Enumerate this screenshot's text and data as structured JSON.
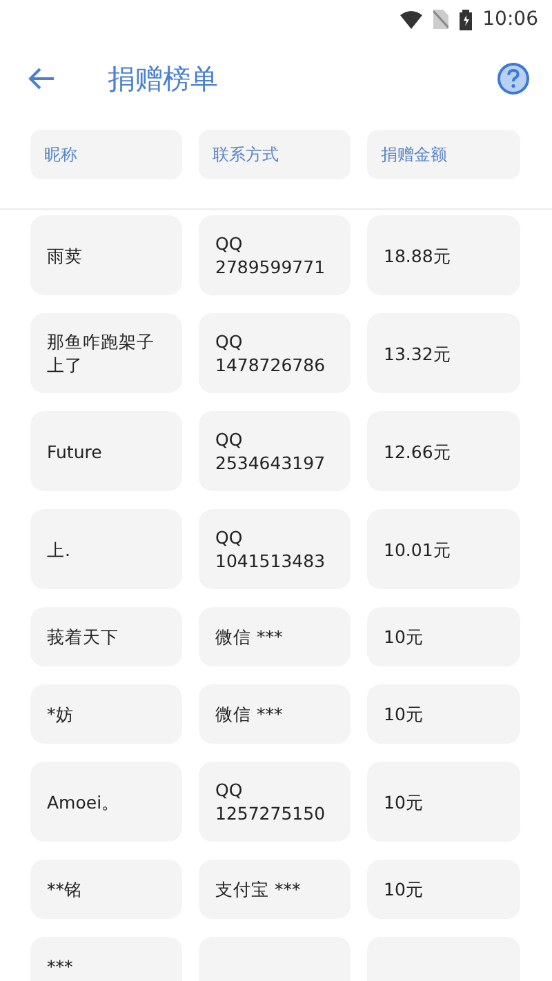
{
  "status_bar": {
    "time": "10:06"
  },
  "toolbar": {
    "title": "捐赠榜单"
  },
  "table": {
    "columns": [
      "昵称",
      "联系方式",
      "捐赠金额"
    ],
    "rows": [
      {
        "nickname": "雨荬",
        "contact": "QQ\n2789599771",
        "amount": "18.88元"
      },
      {
        "nickname": "那鱼咋跑架子上了",
        "contact": "QQ\n1478726786",
        "amount": "13.32元"
      },
      {
        "nickname": "Future",
        "contact": "QQ\n2534643197",
        "amount": "12.66元"
      },
      {
        "nickname": "上.",
        "contact": "QQ\n1041513483",
        "amount": "10.01元"
      },
      {
        "nickname": "莪着天下",
        "contact": "微信 ***",
        "amount": "10元"
      },
      {
        "nickname": "*妨",
        "contact": "微信 ***",
        "amount": "10元"
      },
      {
        "nickname": "Amoei。",
        "contact": "QQ\n1257275150",
        "amount": "10元"
      },
      {
        "nickname": "**铭",
        "contact": "支付宝 ***",
        "amount": "10元"
      },
      {
        "nickname": "***"
      }
    ]
  }
}
